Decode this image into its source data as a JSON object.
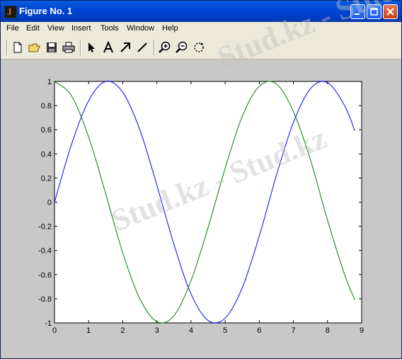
{
  "window": {
    "title": "Figure No. 1",
    "app_icon_glyph": "J"
  },
  "menu": {
    "items": [
      "File",
      "Edit",
      "View",
      "Insert",
      "Tools",
      "Window",
      "Help"
    ]
  },
  "toolbar": {
    "buttons": [
      "new-figure-icon",
      "open-folder-icon",
      "save-icon",
      "print-icon",
      "select-arrow-icon",
      "insert-text-icon",
      "insert-arrow-icon",
      "insert-line-icon",
      "zoom-in-icon",
      "zoom-out-icon",
      "rotate-3d-icon"
    ]
  },
  "watermark": {
    "text": "Stud.kz - Stud.kz"
  },
  "chart_data": {
    "type": "line",
    "xlim": [
      0,
      9
    ],
    "ylim": [
      -1,
      1
    ],
    "xticks": [
      "0",
      "1",
      "2",
      "3",
      "4",
      "5",
      "6",
      "7",
      "8",
      "9"
    ],
    "yticks": [
      "1",
      "0.8",
      "0.6",
      "0.4",
      "0.2",
      "0",
      "-0.2",
      "-0.4",
      "-0.6",
      "-0.8",
      "-1"
    ],
    "grid": false,
    "series": [
      {
        "color": "#0000ff",
        "x": [
          0,
          0.5,
          1,
          1.5,
          2,
          2.5,
          3,
          3.5,
          4,
          4.5,
          5,
          5.5,
          6,
          6.5,
          7,
          7.5,
          8,
          8.5,
          8.8
        ],
        "y": [
          0,
          0.48,
          0.84,
          1.0,
          0.91,
          0.6,
          0.14,
          -0.35,
          -0.76,
          -0.98,
          -0.96,
          -0.71,
          -0.28,
          0.22,
          0.66,
          0.94,
          0.99,
          0.8,
          0.59
        ]
      },
      {
        "color": "#008000",
        "x": [
          0,
          0.5,
          1,
          1.5,
          2,
          2.5,
          3,
          3.5,
          4,
          4.5,
          5,
          5.5,
          6,
          6.5,
          7,
          7.5,
          8,
          8.5,
          8.8
        ],
        "y": [
          1,
          0.88,
          0.54,
          0.07,
          -0.42,
          -0.8,
          -0.99,
          -0.94,
          -0.65,
          -0.21,
          0.28,
          0.71,
          0.96,
          0.98,
          0.75,
          0.35,
          -0.15,
          -0.6,
          -0.81
        ]
      }
    ]
  }
}
